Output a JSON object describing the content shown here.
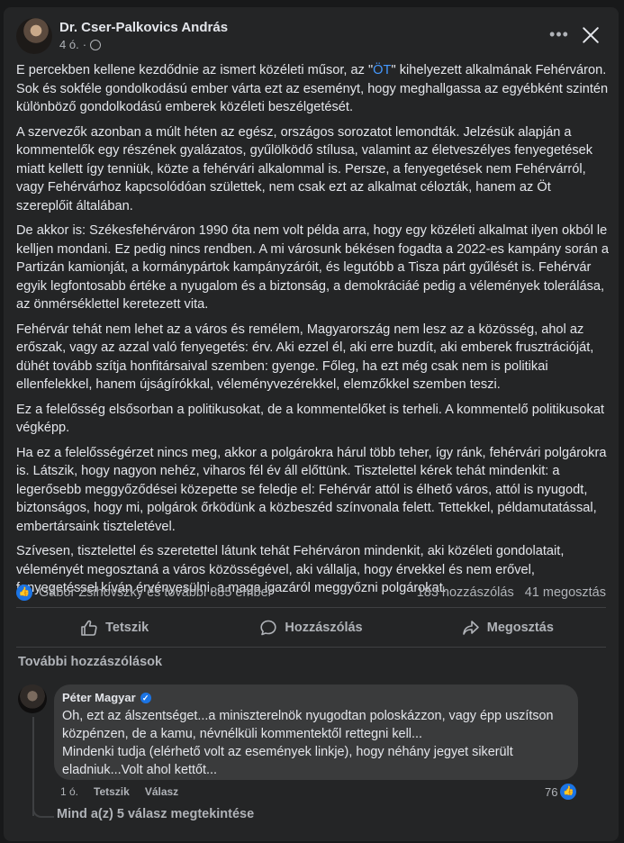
{
  "post": {
    "author": "Dr. Cser-Palkovics András",
    "time": "4 ó.",
    "dot": "·",
    "paragraphs": [
      {
        "pre": "E percekben kellene kezdődnie az ismert közéleti műsor, az \"",
        "tag": "ÖT",
        "post": "\" kihelyezett alkalmának Fehérváron. Sok és sokféle gondolkodású ember várta ezt az eseményt, hogy meghallgassa az egyébként szintén különböző gondolkodású emberek közéleti beszélgetését."
      },
      {
        "text": "A szervezők azonban a múlt héten az egész, országos sorozatot lemondták. Jelzésük alapján a kommentelők egy részének gyalázatos, gyűlölködő stílusa, valamint az életveszélyes fenyegetések miatt kellett így tenniük, közte a fehérvári alkalommal is. Persze, a fenyegetések nem Fehérvárról, vagy Fehérvárhoz kapcsolódóan születtek, nem csak ezt az alkalmat célozták, hanem az Öt szereplőit általában."
      },
      {
        "text": "De akkor is: Székesfehérváron 1990 óta nem volt példa arra, hogy egy közéleti alkalmat ilyen okból le kelljen mondani. Ez pedig nincs rendben. A mi városunk békésen fogadta a 2022-es kampány során a Partizán kamionját, a kormánypártok kampányzáróit, és legutóbb a Tisza párt gyűlését is. Fehérvár egyik legfontosabb értéke a nyugalom és a biztonság, a demokráciáé pedig a vélemények tolerálása, az önmérséklettel keretezett vita."
      },
      {
        "text": "Fehérvár tehát nem lehet az a város és remélem, Magyarország nem lesz az a közösség, ahol az erőszak, vagy az azzal való fenyegetés: érv. Aki ezzel él, aki erre buzdít, aki emberek frusztrációját, dühét tovább szítja honfitársaival szemben: gyenge. Főleg, ha ezt még csak nem is politikai ellenfelekkel, hanem újságírókkal, véleményvezérekkel, elemzőkkel szemben teszi."
      },
      {
        "text": "Ez a felelősség elsősorban a politikusokat, de a kommentelőket is terheli. A kommentelő politikusokat végképp."
      },
      {
        "text": "Ha ez a felelősségérzet nincs meg, akkor a polgárokra hárul több teher, így ránk, fehérvári polgárokra is. Látszik, hogy nagyon nehéz, viharos fél év áll előttünk. Tisztelettel kérek tehát mindenkit: a legerősebb meggyőződései közepette se feledje el: Fehérvár attól is élhető város, attól is nyugodt, biztonságos, hogy mi, polgárok őrködünk a közbeszéd színvonala felett. Tettekkel, példamutatással, embertársaink tiszteletével."
      },
      {
        "text": "Szívesen, tisztelettel és szeretettel látunk tehát Fehérváron mindenkit, aki közéleti gondolatait, véleményét megosztaná a város közösségével, aki vállalja, hogy érvekkel és nem erővel, fenyegetéssel kíván érvényesülni, a maga igazáról meggyőzni polgárokat."
      }
    ]
  },
  "reactions": {
    "reactors": "Gábor Zsihovszky és további 885 ember",
    "comments": "183 hozzászólás",
    "shares": "41 megosztás"
  },
  "actions": {
    "like": "Tetszik",
    "comment": "Hozzászólás",
    "share": "Megosztás"
  },
  "more_comments": "További hozzászólások",
  "comment": {
    "author": "Péter Magyar",
    "lines": [
      "Oh, ezt az álszentséget...a miniszterelnök nyugodtan poloskázzon, vagy épp uszítson közpénzen, de a kamu, névnélküli kommentektől rettegni kell...",
      "Mindenki tudja (elérhető volt az események linkje), hogy néhány jegyet sikerült eladniuk...Volt ahol kettőt..."
    ],
    "time": "1 ó.",
    "like": "Tetszik",
    "reply": "Válasz",
    "likes": "76"
  },
  "view_replies": "Mind a(z) 5 válasz megtekintése",
  "icons": {
    "privacy": "globe-icon",
    "more": "more-options-icon",
    "close": "close-icon",
    "like_badge": "thumbs-up-icon",
    "verified": "verified-badge-icon",
    "like_action": "thumbs-up-outline-icon",
    "comment_action": "speech-bubble-icon",
    "share_action": "share-arrow-icon"
  },
  "colors": {
    "background": "#18191a",
    "card": "#242526",
    "text": "#e4e6eb",
    "secondary": "#b0b3b8",
    "accent": "#1b74e4",
    "hashtag": "#4599ff",
    "bubble": "#3a3b3c"
  }
}
